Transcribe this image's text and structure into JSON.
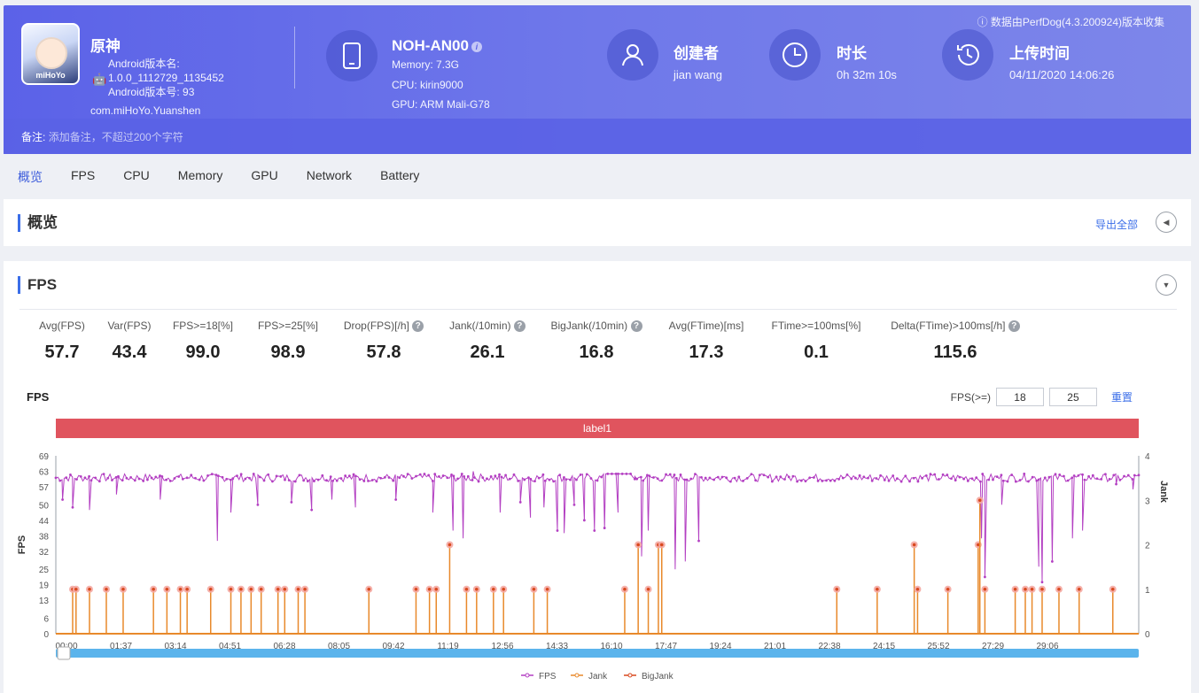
{
  "header": {
    "source_note": "数据由PerfDog(4.3.200924)版本收集",
    "app": {
      "name": "原神",
      "icon_brand": "miHoYo",
      "version_name_label": "Android版本名:",
      "version_name": "1.0.0_1112729_1135452",
      "version_code_label": "Android版本号: 93",
      "package": "com.miHoYo.Yuanshen"
    },
    "device": {
      "model": "NOH-AN00",
      "memory": "Memory: 7.3G",
      "cpu": "CPU: kirin9000",
      "gpu": "GPU: ARM Mali-G78"
    },
    "creator": {
      "title": "创建者",
      "value": "jian wang"
    },
    "duration": {
      "title": "时长",
      "value": "0h 32m 10s"
    },
    "upload": {
      "title": "上传时间",
      "value": "04/11/2020 14:06:26"
    },
    "note": {
      "label": "备注:",
      "placeholder": "添加备注，不超过200个字符"
    }
  },
  "tabs": [
    "概览",
    "FPS",
    "CPU",
    "Memory",
    "GPU",
    "Network",
    "Battery"
  ],
  "overview": {
    "title": "概览",
    "export": "导出全部"
  },
  "fps_panel": {
    "title": "FPS",
    "stats": [
      {
        "label": "Avg(FPS)",
        "value": "57.7",
        "help": false
      },
      {
        "label": "Var(FPS)",
        "value": "43.4",
        "help": false
      },
      {
        "label": "FPS>=18[%]",
        "value": "99.0",
        "help": false
      },
      {
        "label": "FPS>=25[%]",
        "value": "98.9",
        "help": false
      },
      {
        "label": "Drop(FPS)[/h]",
        "value": "57.8",
        "help": true
      },
      {
        "label": "Jank(/10min)",
        "value": "26.1",
        "help": true
      },
      {
        "label": "BigJank(/10min)",
        "value": "16.8",
        "help": true
      },
      {
        "label": "Avg(FTime)[ms]",
        "value": "17.3",
        "help": false
      },
      {
        "label": "FTime>=100ms[%]",
        "value": "0.1",
        "help": false
      },
      {
        "label": "Delta(FTime)>100ms[/h]",
        "value": "115.6",
        "help": true
      }
    ],
    "chart_title": "FPS",
    "threshold_label": "FPS(>=)",
    "threshold_1": "18",
    "threshold_2": "25",
    "reset": "重置"
  },
  "chart_data": {
    "type": "line",
    "band_label": "label1",
    "ylabel_left": "FPS",
    "ylabel_right": "Jank",
    "y_left_ticks": [
      0,
      6,
      13,
      19,
      25,
      32,
      38,
      44,
      50,
      57,
      63,
      69
    ],
    "y_right_ticks": [
      0,
      1,
      2,
      3,
      4
    ],
    "x_ticks": [
      "00:00",
      "01:37",
      "03:14",
      "04:51",
      "06:28",
      "08:05",
      "09:42",
      "11:19",
      "12:56",
      "14:33",
      "16:10",
      "17:47",
      "19:24",
      "21:01",
      "22:38",
      "24:15",
      "25:52",
      "27:29",
      "29:06"
    ],
    "legend": [
      "FPS",
      "Jank",
      "BigJank"
    ],
    "colors": {
      "fps": "#b33fc2",
      "jank": "#e8892b",
      "bigjank": "#d9481e",
      "band": "#e0545e"
    },
    "x_range_min": [
      0,
      32.17
    ],
    "fps_baseline": 60,
    "fps_dips": [
      [
        0.2,
        52
      ],
      [
        0.5,
        49
      ],
      [
        1.0,
        48
      ],
      [
        1.8,
        54
      ],
      [
        3.1,
        52
      ],
      [
        4.8,
        36
      ],
      [
        5.2,
        47
      ],
      [
        6.0,
        50
      ],
      [
        7.0,
        51
      ],
      [
        7.6,
        48
      ],
      [
        8.2,
        52
      ],
      [
        8.9,
        49
      ],
      [
        10.1,
        52
      ],
      [
        11.2,
        47
      ],
      [
        11.8,
        40
      ],
      [
        12.1,
        37
      ],
      [
        12.4,
        63
      ],
      [
        13.2,
        47
      ],
      [
        13.8,
        51
      ],
      [
        14.1,
        45
      ],
      [
        14.5,
        49
      ],
      [
        14.9,
        40
      ],
      [
        15.1,
        39
      ],
      [
        15.4,
        50
      ],
      [
        15.7,
        44
      ],
      [
        16.0,
        40
      ],
      [
        16.3,
        41
      ],
      [
        16.7,
        47
      ],
      [
        17.2,
        61
      ],
      [
        17.4,
        30
      ],
      [
        17.6,
        40
      ],
      [
        18.4,
        25
      ],
      [
        18.7,
        28
      ],
      [
        19.1,
        36
      ],
      [
        27.5,
        37
      ],
      [
        27.6,
        22
      ],
      [
        28.1,
        50
      ],
      [
        29.2,
        26
      ],
      [
        29.3,
        20
      ],
      [
        29.6,
        28
      ],
      [
        30.2,
        37
      ],
      [
        30.5,
        40
      ],
      [
        31.5,
        58
      ],
      [
        32.0,
        56
      ]
    ],
    "jank": [
      [
        0.5,
        1
      ],
      [
        0.6,
        1
      ],
      [
        1.0,
        1
      ],
      [
        1.5,
        1
      ],
      [
        2.0,
        1
      ],
      [
        2.9,
        1
      ],
      [
        3.3,
        1
      ],
      [
        3.7,
        1
      ],
      [
        3.9,
        1
      ],
      [
        4.6,
        1
      ],
      [
        5.2,
        1
      ],
      [
        5.5,
        1
      ],
      [
        5.8,
        1
      ],
      [
        6.1,
        1
      ],
      [
        6.6,
        1
      ],
      [
        6.8,
        1
      ],
      [
        7.2,
        1
      ],
      [
        7.4,
        1
      ],
      [
        9.3,
        1
      ],
      [
        10.7,
        1
      ],
      [
        11.1,
        1
      ],
      [
        11.3,
        1
      ],
      [
        11.7,
        2
      ],
      [
        12.2,
        1
      ],
      [
        12.5,
        1
      ],
      [
        13.0,
        1
      ],
      [
        13.3,
        1
      ],
      [
        14.2,
        1
      ],
      [
        14.6,
        1
      ],
      [
        16.9,
        1
      ],
      [
        17.3,
        2
      ],
      [
        17.6,
        1
      ],
      [
        17.9,
        2
      ],
      [
        18.0,
        2
      ],
      [
        23.2,
        1
      ],
      [
        24.4,
        1
      ],
      [
        25.5,
        2
      ],
      [
        25.6,
        1
      ],
      [
        26.5,
        1
      ],
      [
        27.4,
        2
      ],
      [
        27.45,
        3
      ],
      [
        27.6,
        1
      ],
      [
        28.5,
        1
      ],
      [
        28.8,
        1
      ],
      [
        29.0,
        1
      ],
      [
        29.3,
        1
      ],
      [
        29.8,
        1
      ],
      [
        30.4,
        1
      ],
      [
        31.4,
        1
      ]
    ]
  }
}
